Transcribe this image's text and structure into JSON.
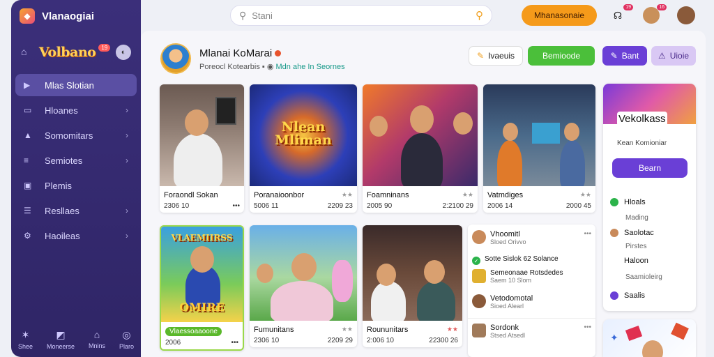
{
  "app": {
    "title": "Vlanaogiai"
  },
  "sidebar": {
    "brand": "Volbano",
    "brand_badge": "19",
    "items": [
      {
        "label": "Mlas Slotian",
        "icon": "play-icon",
        "active": true,
        "chevron": false
      },
      {
        "label": "Hloanes",
        "icon": "doc-icon",
        "active": false,
        "chevron": true
      },
      {
        "label": "Somomitars",
        "icon": "community-icon",
        "active": false,
        "chevron": true
      },
      {
        "label": "Semiotes",
        "icon": "layers-icon",
        "active": false,
        "chevron": true
      },
      {
        "label": "Plemis",
        "icon": "gamepad-icon",
        "active": false,
        "chevron": false
      },
      {
        "label": "Resllaes",
        "icon": "list-icon",
        "active": false,
        "chevron": true
      },
      {
        "label": "Haoileas",
        "icon": "settings-icon",
        "active": false,
        "chevron": true
      }
    ],
    "bottom": [
      {
        "label": "Shee",
        "icon": "star-icon"
      },
      {
        "label": "Moneerse",
        "icon": "chart-icon"
      },
      {
        "label": "Mnins",
        "icon": "home-icon"
      },
      {
        "label": "Plaro",
        "icon": "camera-icon"
      }
    ]
  },
  "topbar": {
    "search_placeholder": "Stani",
    "cta_label": "Mhanasonaie",
    "notif_count": "19",
    "avatar_badge": "16"
  },
  "profile": {
    "name": "Mlanai KoMarai",
    "sub_left": "Poreocl Kotearbis",
    "sub_right": "Mdn ahe In Seornes",
    "buttons": [
      {
        "label": "Ivaeuis",
        "icon": "✎"
      },
      {
        "label": "Bemioode",
        "icon": ""
      },
      {
        "label": "Bant",
        "icon": "✎"
      },
      {
        "label": "Uioie",
        "icon": "⚠"
      }
    ]
  },
  "cards": [
    {
      "title": "Foraondl Sokan",
      "meta_left": "2306 10",
      "meta_right": "•••"
    },
    {
      "title": "Poranaioonbor",
      "meta_left": "5006 11",
      "meta_right": "2209 23"
    },
    {
      "title": "Foamninans",
      "meta_left": "2005 90",
      "meta_right": "2:2100 29"
    },
    {
      "title": "Vatmdiges",
      "meta_left": "2006 14",
      "meta_right": "2000 45"
    },
    {
      "title": "Vlaessoaaoone",
      "meta_left": "2006",
      "meta_right": "•••",
      "overlay": "VLAEMIIRSS",
      "overlay2": "OMIRE"
    },
    {
      "title": "Fumunitans",
      "meta_left": "2306 10",
      "meta_right": "2209 29"
    },
    {
      "title": "Roununitars",
      "meta_left": "2:006 10",
      "meta_right": "22300 26"
    }
  ],
  "card2_overlay": {
    "line1": "Nlean",
    "line2": "Mliman"
  },
  "list": [
    {
      "name": "Vhoomitl",
      "sub": "Sloed Orivvo",
      "dots": "•••",
      "kind": "avatar"
    },
    {
      "name": "Sotte Sislok 62 Solance",
      "sub": "",
      "dots": "",
      "kind": "check"
    },
    {
      "name": "Semeonaae Rotsdedes",
      "sub": "Saem 10 Slom",
      "dots": "",
      "kind": "square"
    },
    {
      "name": "Vetodomotal",
      "sub": "Sioed Alearl",
      "dots": "",
      "kind": "avatar"
    },
    {
      "name": "Sordonk",
      "sub": "Stsed Atsedl",
      "dots": "•••",
      "kind": "square"
    }
  ],
  "right_panel": {
    "title": "Vekolkass",
    "subtitle": "Kean Komioniar",
    "button": "Bearn",
    "rows": [
      {
        "label": "Hloals",
        "sub": "Mading",
        "color": "#2bb34a"
      },
      {
        "label": "Saolotac",
        "sub": "Pirstes",
        "color": "#c98a5a"
      },
      {
        "label": "Haloon",
        "sub": "Saamioleirg",
        "color": "transparent"
      },
      {
        "label": "Saalis",
        "sub": "",
        "color": "#6a3fd6"
      }
    ]
  }
}
